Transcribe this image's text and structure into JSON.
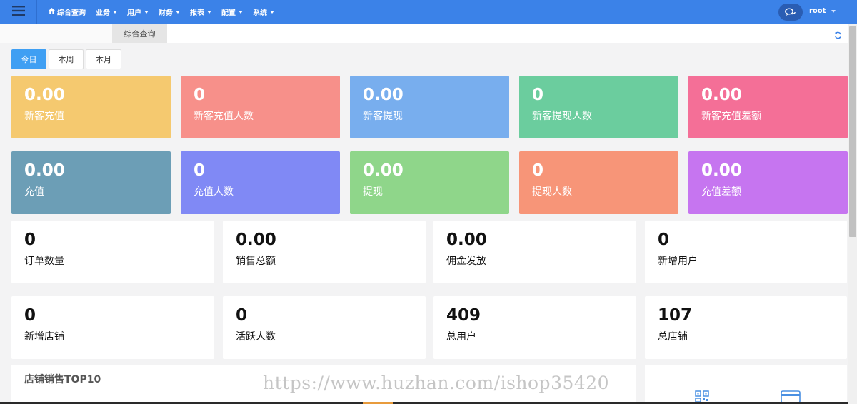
{
  "nav": {
    "items": [
      {
        "label": "综合查询",
        "icon": "home-icon",
        "caret": false
      },
      {
        "label": "业务",
        "caret": true
      },
      {
        "label": "用户",
        "caret": true
      },
      {
        "label": "财务",
        "caret": true
      },
      {
        "label": "报表",
        "caret": true
      },
      {
        "label": "配置",
        "caret": true
      },
      {
        "label": "系统",
        "caret": true
      }
    ],
    "user": "root"
  },
  "tabs": {
    "active": "综合查询"
  },
  "periods": {
    "today": "今日",
    "week": "本周",
    "month": "本月"
  },
  "row1": [
    {
      "value": "0.00",
      "label": "新客充值",
      "color": "#f5c96f"
    },
    {
      "value": "0",
      "label": "新客充值人数",
      "color": "#f7908a"
    },
    {
      "value": "0.00",
      "label": "新客提现",
      "color": "#78aeee"
    },
    {
      "value": "0",
      "label": "新客提现人数",
      "color": "#6bcd9e"
    },
    {
      "value": "0.00",
      "label": "新客充值差额",
      "color": "#f46f97"
    }
  ],
  "row2": [
    {
      "value": "0.00",
      "label": "充值",
      "color": "#6c9eb6"
    },
    {
      "value": "0",
      "label": "充值人数",
      "color": "#8089f5"
    },
    {
      "value": "0.00",
      "label": "提现",
      "color": "#8fd68a"
    },
    {
      "value": "0",
      "label": "提现人数",
      "color": "#f79578"
    },
    {
      "value": "0.00",
      "label": "充值差额",
      "color": "#c675f0"
    }
  ],
  "row3": [
    {
      "value": "0",
      "label": "订单数量"
    },
    {
      "value": "0.00",
      "label": "销售总额"
    },
    {
      "value": "0.00",
      "label": "佣金发放"
    },
    {
      "value": "0",
      "label": "新增用户"
    }
  ],
  "row4": [
    {
      "value": "0",
      "label": "新增店铺"
    },
    {
      "value": "0",
      "label": "活跃人数"
    },
    {
      "value": "409",
      "label": "总用户"
    },
    {
      "value": "107",
      "label": "总店铺"
    }
  ],
  "panel": {
    "top10_title": "店铺销售TOP10"
  },
  "watermark": "https://www.huzhan.com/ishop35420"
}
